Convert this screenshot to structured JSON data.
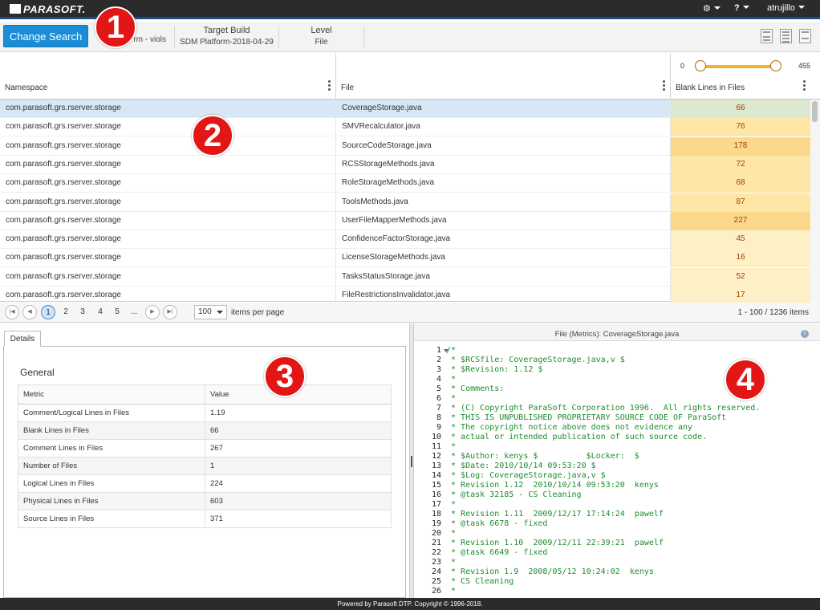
{
  "topbar": {
    "logo": "PARASOFT.",
    "user": "atrujillo"
  },
  "searchbar": {
    "change_search_label": "Change Search",
    "filter_value": "rm - viols",
    "target_build": {
      "title": "Target Build",
      "value": "SDM Platform-2018-04-29"
    },
    "level": {
      "title": "Level",
      "value": "File"
    }
  },
  "grid": {
    "columns": [
      "Namespace",
      "File",
      "Blank Lines in Files"
    ],
    "slider": {
      "min": "0",
      "max": "455"
    },
    "rows": [
      {
        "namespace": "com.parasoft.grs.rserver.storage",
        "file": "CoverageStorage.java",
        "blank": "66"
      },
      {
        "namespace": "com.parasoft.grs.rserver.storage",
        "file": "SMVRecalculator.java",
        "blank": "76"
      },
      {
        "namespace": "com.parasoft.grs.rserver.storage",
        "file": "SourceCodeStorage.java",
        "blank": "178"
      },
      {
        "namespace": "com.parasoft.grs.rserver.storage",
        "file": "RCSStorageMethods.java",
        "blank": "72"
      },
      {
        "namespace": "com.parasoft.grs.rserver.storage",
        "file": "RoleStorageMethods.java",
        "blank": "68"
      },
      {
        "namespace": "com.parasoft.grs.rserver.storage",
        "file": "ToolsMethods.java",
        "blank": "87"
      },
      {
        "namespace": "com.parasoft.grs.rserver.storage",
        "file": "UserFileMapperMethods.java",
        "blank": "227"
      },
      {
        "namespace": "com.parasoft.grs.rserver.storage",
        "file": "ConfidenceFactorStorage.java",
        "blank": "45"
      },
      {
        "namespace": "com.parasoft.grs.rserver.storage",
        "file": "LicenseStorageMethods.java",
        "blank": "16"
      },
      {
        "namespace": "com.parasoft.grs.rserver.storage",
        "file": "TasksStatusStorage.java",
        "blank": "52"
      },
      {
        "namespace": "com.parasoft.grs.rserver.storage",
        "file": "FileRestrictionsInvalidator.java",
        "blank": "17"
      }
    ],
    "colors": {
      "heat_light": "#fdf0c7",
      "heat_mid": "#fde6a6",
      "heat_high": "#fcd98a"
    }
  },
  "pager": {
    "pages": [
      "1",
      "2",
      "3",
      "4",
      "5",
      "..."
    ],
    "per_page": "100",
    "per_page_label": "items per page",
    "range": "1 - 100 / 1236 items"
  },
  "details": {
    "tab": "Details",
    "section": "General",
    "headers": [
      "Metric",
      "Value"
    ],
    "metrics": [
      {
        "name": "Comment/Logical Lines in Files",
        "value": "1.19"
      },
      {
        "name": "Blank Lines in Files",
        "value": "66"
      },
      {
        "name": "Comment Lines in Files",
        "value": "267"
      },
      {
        "name": "Number of Files",
        "value": "1"
      },
      {
        "name": "Logical Lines in Files",
        "value": "224"
      },
      {
        "name": "Physical Lines in Files",
        "value": "603"
      },
      {
        "name": "Source Lines in Files",
        "value": "371"
      }
    ]
  },
  "source": {
    "title": "File (Metrics): CoverageStorage.java",
    "lines": [
      "/*",
      " * $RCSfile: CoverageStorage.java,v $",
      " * $Revision: 1.12 $",
      " *",
      " * Comments:",
      " *",
      " * (C) Copyright ParaSoft Corporation 1996.  All rights reserved.",
      " * THIS IS UNPUBLISHED PROPRIETARY SOURCE CODE OF ParaSoft",
      " * The copyright notice above does not evidence any",
      " * actual or intended publication of such source code.",
      " *",
      " * $Author: kenys $          $Locker:  $",
      " * $Date: 2010/10/14 09:53:20 $",
      " * $Log: CoverageStorage.java,v $",
      " * Revision 1.12  2010/10/14 09:53:20  kenys",
      " * @task 32185 - CS Cleaning",
      " *",
      " * Revision 1.11  2009/12/17 17:14:24  pawelf",
      " * @task 6678 - fixed",
      " *",
      " * Revision 1.10  2009/12/11 22:39:21  pawelf",
      " * @task 6649 - fixed",
      " *",
      " * Revision 1.9  2008/05/12 10:24:02  kenys",
      " * CS Cleaning",
      " *"
    ]
  },
  "footer": "Powered by Parasoft DTP. Copyright © 1996-2018.",
  "markers": [
    "1",
    "2",
    "3",
    "4"
  ]
}
